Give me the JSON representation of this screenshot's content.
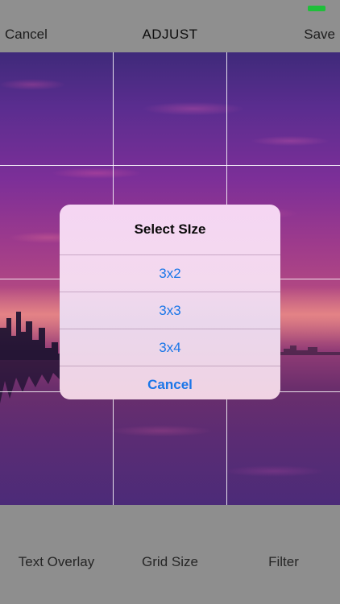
{
  "status_bar": {
    "battery_color": "#1fbf3a"
  },
  "nav": {
    "left_label": "Cancel",
    "title": "ADJUST",
    "right_label": "Save"
  },
  "photo": {
    "description_icon": "sunset-photo",
    "grid": {
      "columns": 3,
      "rows": 4
    }
  },
  "dialog": {
    "title": "Select SIze",
    "options": [
      {
        "label": "3x2"
      },
      {
        "label": "3x3"
      },
      {
        "label": "3x4"
      }
    ],
    "cancel_label": "Cancel",
    "accent_color": "#1a76e8"
  },
  "toolbar": {
    "items": [
      {
        "label": "Text Overlay"
      },
      {
        "label": "Grid Size"
      },
      {
        "label": "Filter"
      }
    ]
  }
}
